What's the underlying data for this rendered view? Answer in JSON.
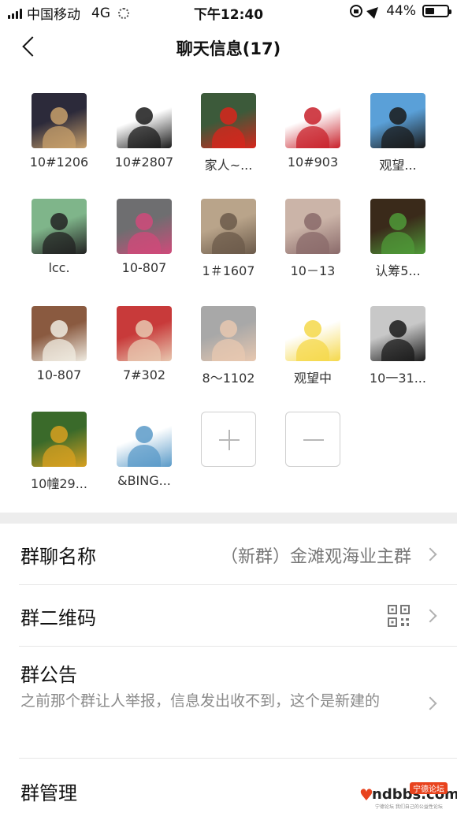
{
  "status_bar": {
    "carrier": "中国移动",
    "network": "4G",
    "time": "下午12:40",
    "battery_text": "44%",
    "battery_level": 0.44
  },
  "nav": {
    "title": "聊天信息(17)"
  },
  "members": [
    {
      "name": "10#1206",
      "avatar_icon": "silhouette-sunset-avatar",
      "colors": [
        "#2c2a3a",
        "#c8a06b"
      ]
    },
    {
      "name": "10#2807",
      "avatar_icon": "ink-warrior-avatar",
      "colors": [
        "#ffffff",
        "#1a1a1a"
      ]
    },
    {
      "name": "家人~...",
      "avatar_icon": "incense-flag-avatar",
      "colors": [
        "#3c5a3a",
        "#d8261c"
      ]
    },
    {
      "name": "10#903",
      "avatar_icon": "cartoon-hero-avatar",
      "colors": [
        "#ffffff",
        "#c8202a"
      ]
    },
    {
      "name": "观望...",
      "avatar_icon": "anime-girl-avatar",
      "colors": [
        "#5aa0d8",
        "#1a1a1a"
      ]
    },
    {
      "name": "lcc.",
      "avatar_icon": "cartoon-face-avatar",
      "colors": [
        "#7fb58a",
        "#222222"
      ]
    },
    {
      "name": "10-807",
      "avatar_icon": "flower-vase-avatar",
      "colors": [
        "#6e6e70",
        "#d04a7a"
      ]
    },
    {
      "name": "1＃1607",
      "avatar_icon": "old-street-avatar",
      "colors": [
        "#b9a48a",
        "#6b5a4a"
      ]
    },
    {
      "name": "10－13",
      "avatar_icon": "street-people-avatar",
      "colors": [
        "#cbb4a8",
        "#8a6a6a"
      ]
    },
    {
      "name": "认筹5...",
      "avatar_icon": "potted-plant-avatar",
      "colors": [
        "#3a2a1a",
        "#4f9a38"
      ]
    },
    {
      "name": "10-807",
      "avatar_icon": "bowl-spoon-avatar",
      "colors": [
        "#8a5a40",
        "#f0ece2"
      ]
    },
    {
      "name": "7#302",
      "avatar_icon": "baby-photo-avatar",
      "colors": [
        "#c83a3a",
        "#e8c8b0"
      ]
    },
    {
      "name": "8～1102",
      "avatar_icon": "holding-hands-avatar",
      "colors": [
        "#a8a8a8",
        "#e8c8b0"
      ]
    },
    {
      "name": "观望中",
      "avatar_icon": "cute-cat-avatar",
      "colors": [
        "#ffffff",
        "#f5d84a"
      ]
    },
    {
      "name": "10一31...",
      "avatar_icon": "man-standing-avatar",
      "colors": [
        "#c8c8c8",
        "#1a1a1a"
      ]
    },
    {
      "name": "10幢29...",
      "avatar_icon": "man-gold-statue-avatar",
      "colors": [
        "#3a6a2a",
        "#d8a020"
      ]
    },
    {
      "name": "&BING...",
      "avatar_icon": "beach-collage-avatar",
      "colors": [
        "#ffffff",
        "#5a9ac8"
      ]
    }
  ],
  "member_actions": {
    "add_icon": "plus-icon",
    "remove_icon": "minus-icon"
  },
  "settings": {
    "group_name_label": "群聊名称",
    "group_name_value": "（新群）金滩观海业主群",
    "qr_label": "群二维码",
    "qr_icon": "qr-code-icon",
    "notice_label": "群公告",
    "notice_text": "之前那个群让人举报，信息发出收不到，这个是新建的",
    "manage_label": "群管理"
  },
  "watermark": {
    "brand": "ndbbs.com",
    "badge": "宁德论坛",
    "tagline": "宁德论坛 我们自己的公益性论坛"
  }
}
